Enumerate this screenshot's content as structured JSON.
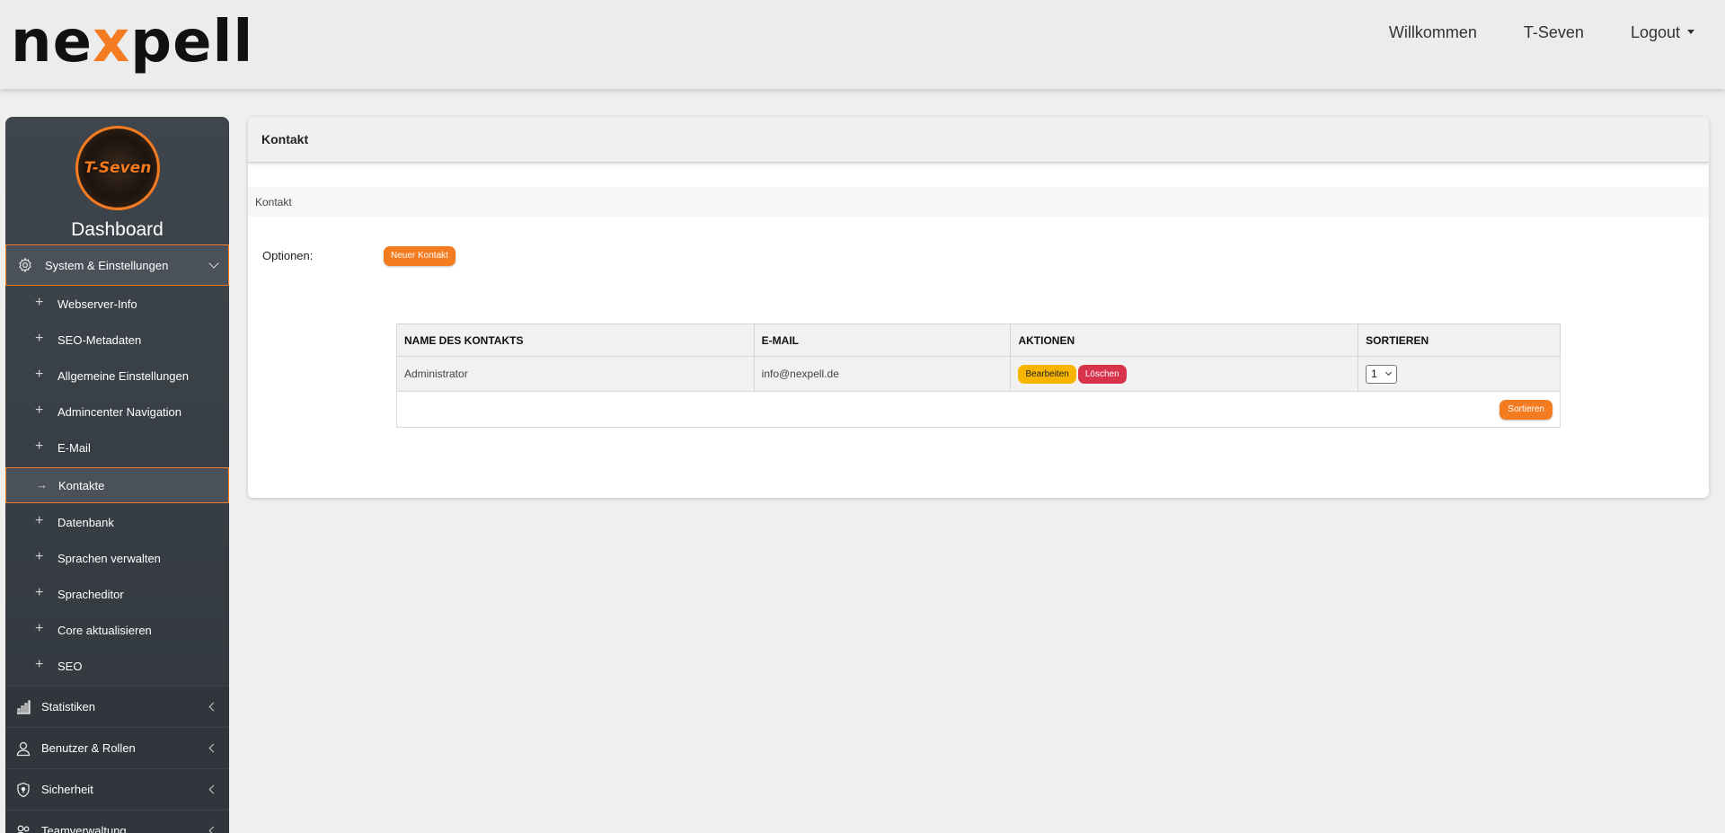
{
  "header": {
    "logo_prefix": "ne",
    "logo_x": "x",
    "logo_suffix": "pell",
    "nav": {
      "welcome": "Willkommen",
      "user": "T-Seven",
      "logout": "Logout"
    }
  },
  "sidebar": {
    "avatar_text": "T-Seven",
    "title": "Dashboard",
    "group": {
      "label": "System & Einstellungen",
      "icon": "gear-icon",
      "expanded": true
    },
    "sub_items": [
      {
        "label": "Webserver-Info",
        "active": false
      },
      {
        "label": "SEO-Metadaten",
        "active": false
      },
      {
        "label": "Allgemeine Einstellungen",
        "active": false
      },
      {
        "label": "Admincenter Navigation",
        "active": false
      },
      {
        "label": "E-Mail",
        "active": false
      },
      {
        "label": "Kontakte",
        "active": true
      },
      {
        "label": "Datenbank",
        "active": false
      },
      {
        "label": "Sprachen verwalten",
        "active": false
      },
      {
        "label": "Spracheditor",
        "active": false
      },
      {
        "label": "Core aktualisieren",
        "active": false
      },
      {
        "label": "SEO",
        "active": false
      }
    ],
    "main_items": [
      {
        "label": "Statistiken",
        "icon": "bar-chart-icon"
      },
      {
        "label": "Benutzer & Rollen",
        "icon": "user-icon"
      },
      {
        "label": "Sicherheit",
        "icon": "shield-icon"
      },
      {
        "label": "Teamverwaltung",
        "icon": "team-icon"
      }
    ],
    "accent_color": "#f47b20"
  },
  "content": {
    "card_title": "Kontakt",
    "breadcrumb": "Kontakt",
    "options_label": "Optionen:",
    "new_button": "Neuer Kontakt",
    "table": {
      "headers": [
        "NAME DES KONTAKTS",
        "E-MAIL",
        "AKTIONEN",
        "SORTIEREN"
      ],
      "rows": [
        {
          "name": "Administrator",
          "email": "info@nexpell.de",
          "edit_label": "Bearbeiten",
          "delete_label": "Löschen",
          "sort_value": "1"
        }
      ],
      "sort_button": "Sortieren"
    }
  }
}
